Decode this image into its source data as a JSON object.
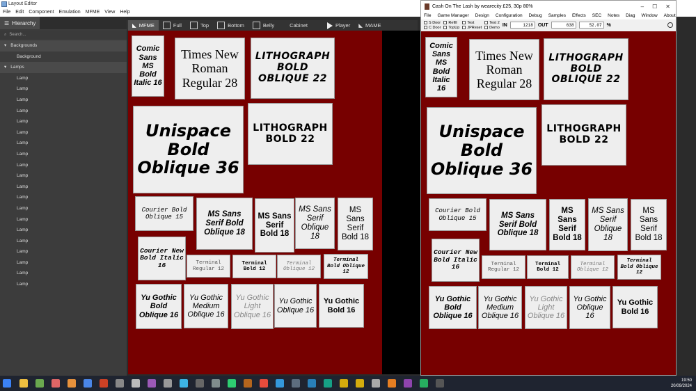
{
  "app": {
    "window_title": "Layout Editor",
    "menu": [
      "File",
      "Edit",
      "Component",
      "Emulation",
      "MFME",
      "View",
      "Help"
    ]
  },
  "hierarchy": {
    "tab_label": "Hierarchy",
    "search_placeholder": "Search...",
    "backgrounds_label": "Backgrounds",
    "background_item": "Background",
    "lamps_label": "Lamps",
    "lamp_item": "Lamp"
  },
  "toolbar": {
    "tabs": [
      {
        "label": "MFME",
        "kind": "icon"
      },
      {
        "label": "Full",
        "kind": "check"
      },
      {
        "label": "Top",
        "kind": "check"
      },
      {
        "label": "Bottom",
        "kind": "check"
      },
      {
        "label": "Belly",
        "kind": "check"
      },
      {
        "label": "Cabinet",
        "kind": "plain"
      },
      {
        "label": "Player",
        "kind": "play"
      },
      {
        "label": "MAME",
        "kind": "icon"
      }
    ]
  },
  "game": {
    "title": "Cash On The Lash by wearecity £25, 30p 80%",
    "menu": [
      "File",
      "Game Manager",
      "Design",
      "Configuration",
      "Debug",
      "Samples",
      "Effects",
      "SEC",
      "Notes",
      "Diag",
      "Window",
      "About"
    ],
    "checks": [
      "S Door",
      "C Door",
      "Refill",
      "TopUp",
      "Test",
      "JPReset",
      "Test 2",
      "Demo"
    ],
    "in_label": "IN",
    "in_value": "1218",
    "out_label": "OUT",
    "out_value": "638",
    "pct_value": "52.07",
    "pct_label": "%"
  },
  "left_boxes": [
    {
      "text": "Comic Sans MS Bold Italic 16"
    },
    {
      "text": "Times New Roman Regular 28"
    },
    {
      "text": "LITHOGRAPH BOLD OBLIQUE 22"
    },
    {
      "text": "Unispace Bold Oblique 36"
    },
    {
      "text": "LITHOGRAPH BOLD 22"
    },
    {
      "text": "Courier Bold Oblique 15"
    },
    {
      "text": "MS Sans Serif Bold Oblique 18"
    },
    {
      "text": "MS Sans Serif Bold 18"
    },
    {
      "text": "MS Sans Serif Oblique 18"
    },
    {
      "text": "MS Sans Serif Bold 18"
    },
    {
      "text": "Courier New Bold Italic 16"
    },
    {
      "text": "Terminal Regular 12"
    },
    {
      "text": "Terminal Bold 12"
    },
    {
      "text": "Terminal Oblique 12"
    },
    {
      "text": "Terminal Bold Oblique 12"
    },
    {
      "text": "Yu Gothic Bold Oblique 16"
    },
    {
      "text": "Yu Gothic Medium Oblique 16"
    },
    {
      "text": "Yu Gothic Light Oblique 16"
    },
    {
      "text": "Yu Gothic Oblique 16"
    },
    {
      "text": "Yu Gothic Bold 16"
    }
  ],
  "right_boxes": [
    {
      "text": "Comic Sans MS Bold Italic 16"
    },
    {
      "text": "Times New Roman Regular 28"
    },
    {
      "text": "LITHOGRAPH BOLD OBLIQUE 22"
    },
    {
      "text": "Unispace Bold Oblique 36"
    },
    {
      "text": "LITHOGRAPH BOLD 22"
    },
    {
      "text": "Courier Bold Oblique 15"
    },
    {
      "text": "MS Sans Serif Bold Oblique 18"
    },
    {
      "text": "MS Sans Serif Bold 18"
    },
    {
      "text": "MS Sans Serif Oblique 18"
    },
    {
      "text": "MS Sans Serif Bold 18"
    },
    {
      "text": "Courier New Bold Italic 16"
    },
    {
      "text": "Terminal Regular 12"
    },
    {
      "text": "Terminal Bold 12"
    },
    {
      "text": "Terminal Oblique 12"
    },
    {
      "text": "Terminal Bold Oblique 12"
    },
    {
      "text": "Yu Gothic Bold Oblique 16"
    },
    {
      "text": "Yu Gothic Medium Oblique 16"
    },
    {
      "text": "Yu Gothic Light Oblique 16"
    },
    {
      "text": "Yu Gothic Oblique 16"
    },
    {
      "text": "Yu Gothic Bold 16"
    }
  ],
  "taskbar": {
    "time": "19:50",
    "date": "20/09/2024"
  },
  "colors": {
    "canvas": "#770000",
    "panel": "#3c3c3c",
    "taskbar": "#1f2430"
  }
}
